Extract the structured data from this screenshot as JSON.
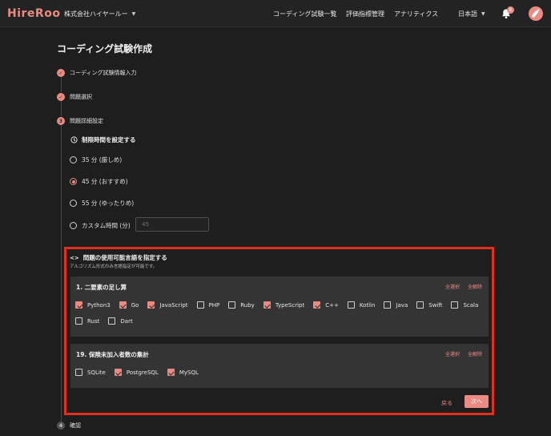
{
  "header": {
    "logo": "HireRoo",
    "org": "株式会社ハイヤールー",
    "nav": [
      "コーディング試験一覧",
      "評価指標管理",
      "アナリティクス"
    ],
    "language": "日本語",
    "notification_count": "6"
  },
  "page": {
    "title": "コーディング試験作成"
  },
  "steps": [
    {
      "label": "コーディング試験情報入力",
      "state": "done"
    },
    {
      "label": "問題選択",
      "state": "done"
    },
    {
      "label": "問題詳細設定",
      "number": "3",
      "state": "active"
    },
    {
      "label": "確認",
      "number": "4",
      "state": "todo"
    }
  ],
  "time_limit": {
    "heading": "制限時間を設定する",
    "options": [
      {
        "label": "35 分 (厳しめ)",
        "selected": false
      },
      {
        "label": "45 分 (おすすめ)",
        "selected": true
      },
      {
        "label": "55 分 (ゆったりめ)",
        "selected": false
      },
      {
        "label": "カスタム時間 (分)",
        "selected": false
      }
    ],
    "custom_placeholder": "45"
  },
  "languages": {
    "heading": "問題の使用可能言語を指定する",
    "subtext": "アルゴリズム形式のみ言語指定が可能です。",
    "select_all": "全選択",
    "clear_all": "全解除",
    "questions": [
      {
        "title": "1. 二要素の足し算",
        "langs": [
          {
            "name": "Python3",
            "checked": true
          },
          {
            "name": "Go",
            "checked": true
          },
          {
            "name": "JavaScript",
            "checked": true
          },
          {
            "name": "PHP",
            "checked": false
          },
          {
            "name": "Ruby",
            "checked": false
          },
          {
            "name": "TypeScript",
            "checked": true
          },
          {
            "name": "C++",
            "checked": true
          },
          {
            "name": "Kotlin",
            "checked": false
          },
          {
            "name": "Java",
            "checked": false
          },
          {
            "name": "Swift",
            "checked": false
          },
          {
            "name": "Scala",
            "checked": false
          },
          {
            "name": "Rust",
            "checked": false
          },
          {
            "name": "Dart",
            "checked": false
          }
        ]
      },
      {
        "title": "19. 保険未加入者数の集計",
        "langs": [
          {
            "name": "SQLite",
            "checked": false
          },
          {
            "name": "PostgreSQL",
            "checked": true
          },
          {
            "name": "MySQL",
            "checked": true
          }
        ]
      }
    ]
  },
  "actions": {
    "back": "戻る",
    "next": "次へ"
  },
  "colors": {
    "accent": "#e98b83",
    "highlight": "#e0301e",
    "background": "#1e1e1e"
  }
}
